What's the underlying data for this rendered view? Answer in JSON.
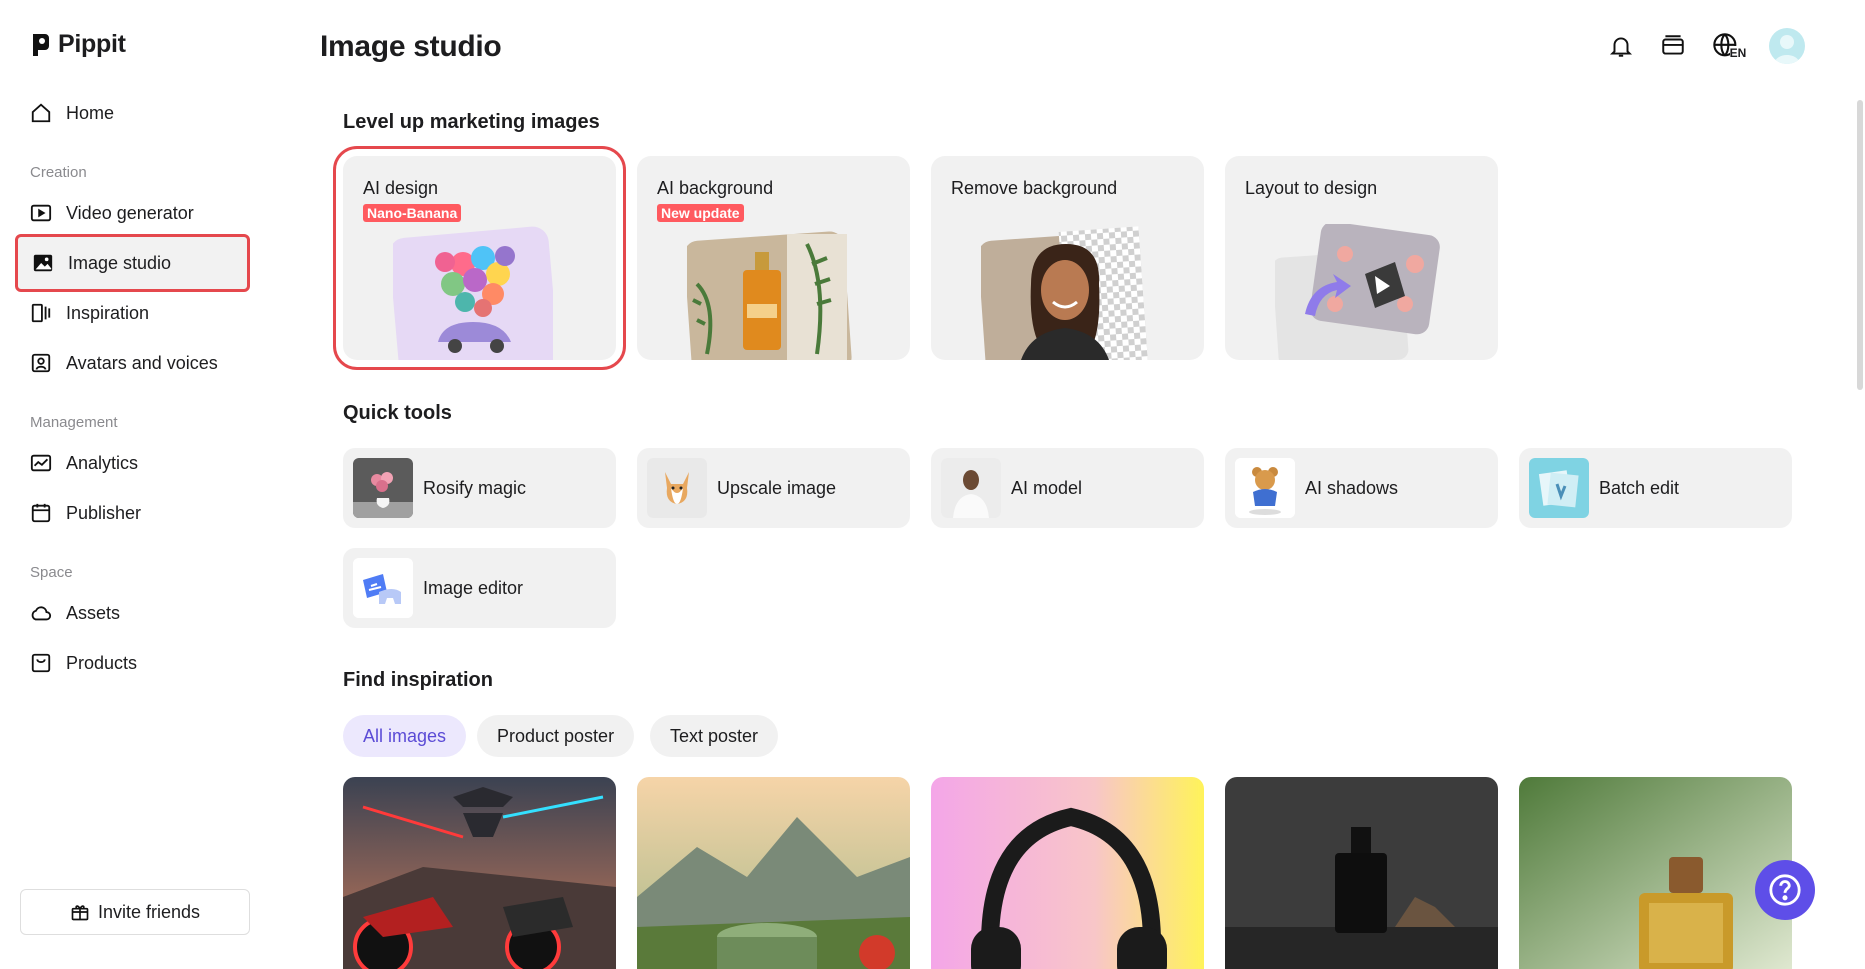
{
  "brand": {
    "name": "Pippit"
  },
  "sidebar": {
    "home": "Home",
    "sections": {
      "creation": "Creation",
      "management": "Management",
      "space": "Space"
    },
    "items": [
      {
        "label": "Video generator"
      },
      {
        "label": "Image studio"
      },
      {
        "label": "Inspiration"
      },
      {
        "label": "Avatars and voices"
      },
      {
        "label": "Analytics"
      },
      {
        "label": "Publisher"
      },
      {
        "label": "Assets"
      },
      {
        "label": "Products"
      }
    ],
    "invite": "Invite friends"
  },
  "header": {
    "title": "Image studio",
    "language": "EN",
    "icons": [
      "bell-icon",
      "card-icon",
      "globe-icon",
      "avatar"
    ]
  },
  "level_up": {
    "title": "Level up marketing images",
    "cards": [
      {
        "title": "AI design",
        "badge": "Nano-Banana"
      },
      {
        "title": "AI background",
        "badge": "New update"
      },
      {
        "title": "Remove background",
        "badge": ""
      },
      {
        "title": "Layout to design",
        "badge": ""
      }
    ]
  },
  "quick_tools": {
    "title": "Quick tools",
    "items": [
      {
        "label": "Rosify magic"
      },
      {
        "label": "Upscale image"
      },
      {
        "label": "AI model"
      },
      {
        "label": "AI shadows"
      },
      {
        "label": "Batch edit"
      },
      {
        "label": "Image editor"
      }
    ]
  },
  "inspiration": {
    "title": "Find inspiration",
    "filters": [
      {
        "label": "All images",
        "active": true
      },
      {
        "label": "Product poster",
        "active": false
      },
      {
        "label": "Text poster",
        "active": false
      }
    ]
  },
  "colors": {
    "accent": "#5e4ee8",
    "highlight": "#e5484d",
    "badge": "#ff5a5f",
    "card_bg": "#f1f1f1"
  }
}
